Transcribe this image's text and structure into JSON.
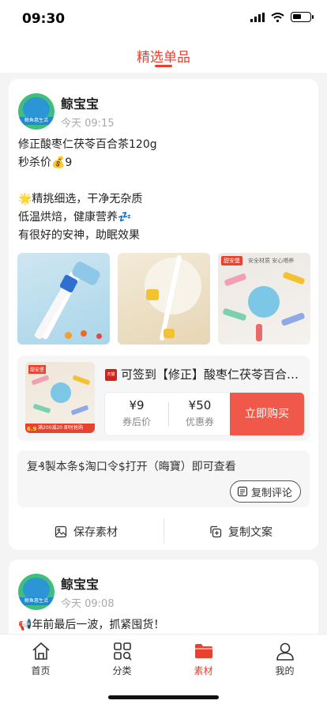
{
  "status_bar": {
    "time": "09:30",
    "battery_level": 0.55
  },
  "header": {
    "title": "精选单品"
  },
  "posts": [
    {
      "author": "鲸宝宝",
      "avatar_text": "鲸鱼惠生活",
      "time": "今天 09:15",
      "lines": [
        "修正酸枣仁茯苓百合茶120g",
        "秒杀价💰9",
        "",
        "🌟精挑细选，干净无杂质",
        "低温烘焙，健康营养💤",
        "有很好的安神，助眠效果"
      ],
      "photos": [
        {
          "name": "product-photo-1"
        },
        {
          "name": "product-photo-2"
        },
        {
          "name": "product-photo-3",
          "badge": "甜安堡",
          "caption": "安全材质  安心喂养"
        }
      ],
      "product": {
        "platform_badge": "天猫",
        "title": "可签到【修正】酸枣仁茯苓百合茶120g",
        "thumb_badge": "甜安堡",
        "thumb_price": "6.9",
        "thumb_foot": "满200减20 即时抢购",
        "after_coupon_price": "¥9",
        "after_coupon_label": "券后价",
        "coupon_value": "¥50",
        "coupon_label": "优惠券",
        "buy_label": "立即购买"
      },
      "command_text": "复₰製本条$淘口令$打开（晦寶）即可查看",
      "copy_comment_label": "复制评论",
      "save_material_label": "保存素材",
      "copy_text_label": "复制文案"
    },
    {
      "author": "鲸宝宝",
      "avatar_text": "鲸鱼惠生活",
      "time": "今天 09:08",
      "lines": [
        "📢年前最后一波，抓紧囤货！"
      ]
    }
  ],
  "tabbar": [
    {
      "label": "首页",
      "icon": "home-icon",
      "active": false
    },
    {
      "label": "分类",
      "icon": "category-icon",
      "active": false
    },
    {
      "label": "素材",
      "icon": "folder-icon",
      "active": true
    },
    {
      "label": "我的",
      "icon": "profile-icon",
      "active": false
    }
  ],
  "colors": {
    "accent": "#e8412f",
    "buy_button": "#f0584a"
  }
}
